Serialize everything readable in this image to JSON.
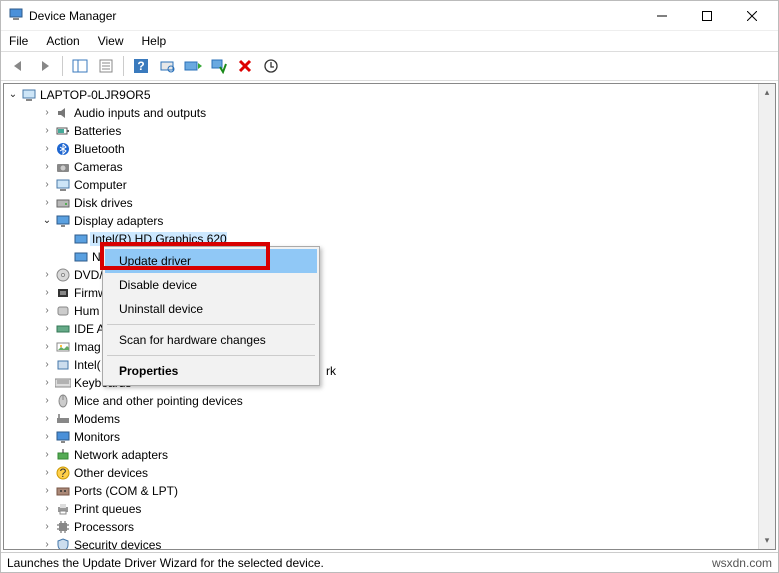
{
  "window": {
    "title": "Device Manager"
  },
  "menu": {
    "file": "File",
    "action": "Action",
    "view": "View",
    "help": "Help"
  },
  "tree": {
    "root": "LAPTOP-0LJR9OR5",
    "items": [
      {
        "label": "Audio inputs and outputs",
        "expanded": false,
        "indent": 2
      },
      {
        "label": "Batteries",
        "expanded": false,
        "indent": 2
      },
      {
        "label": "Bluetooth",
        "expanded": false,
        "indent": 2
      },
      {
        "label": "Cameras",
        "expanded": false,
        "indent": 2
      },
      {
        "label": "Computer",
        "expanded": false,
        "indent": 2
      },
      {
        "label": "Disk drives",
        "expanded": false,
        "indent": 2
      },
      {
        "label": "Display adapters",
        "expanded": true,
        "indent": 2
      },
      {
        "label": "Intel(R) HD Graphics 620",
        "expanded": null,
        "indent": 3,
        "selected": true
      },
      {
        "label": "N",
        "expanded": null,
        "indent": 3,
        "truncR": "rk"
      },
      {
        "label": "DVD/",
        "expanded": false,
        "indent": 2
      },
      {
        "label": "Firmw",
        "expanded": false,
        "indent": 2
      },
      {
        "label": "Hum",
        "expanded": false,
        "indent": 2
      },
      {
        "label": "IDE A",
        "expanded": false,
        "indent": 2
      },
      {
        "label": "Imag",
        "expanded": false,
        "indent": 2
      },
      {
        "label": "Intel(",
        "expanded": false,
        "indent": 2
      },
      {
        "label": "Keyboards",
        "expanded": false,
        "indent": 2
      },
      {
        "label": "Mice and other pointing devices",
        "expanded": false,
        "indent": 2
      },
      {
        "label": "Modems",
        "expanded": false,
        "indent": 2
      },
      {
        "label": "Monitors",
        "expanded": false,
        "indent": 2
      },
      {
        "label": "Network adapters",
        "expanded": false,
        "indent": 2
      },
      {
        "label": "Other devices",
        "expanded": false,
        "indent": 2
      },
      {
        "label": "Ports (COM & LPT)",
        "expanded": false,
        "indent": 2
      },
      {
        "label": "Print queues",
        "expanded": false,
        "indent": 2
      },
      {
        "label": "Processors",
        "expanded": false,
        "indent": 2
      },
      {
        "label": "Security devices",
        "expanded": false,
        "indent": 2
      }
    ],
    "truncation_right": "rk"
  },
  "context_menu": {
    "update": "Update driver",
    "disable": "Disable device",
    "uninstall": "Uninstall device",
    "scan": "Scan for hardware changes",
    "properties": "Properties"
  },
  "status": {
    "text": "Launches the Update Driver Wizard for the selected device.",
    "watermark": "wsxdn.com"
  }
}
